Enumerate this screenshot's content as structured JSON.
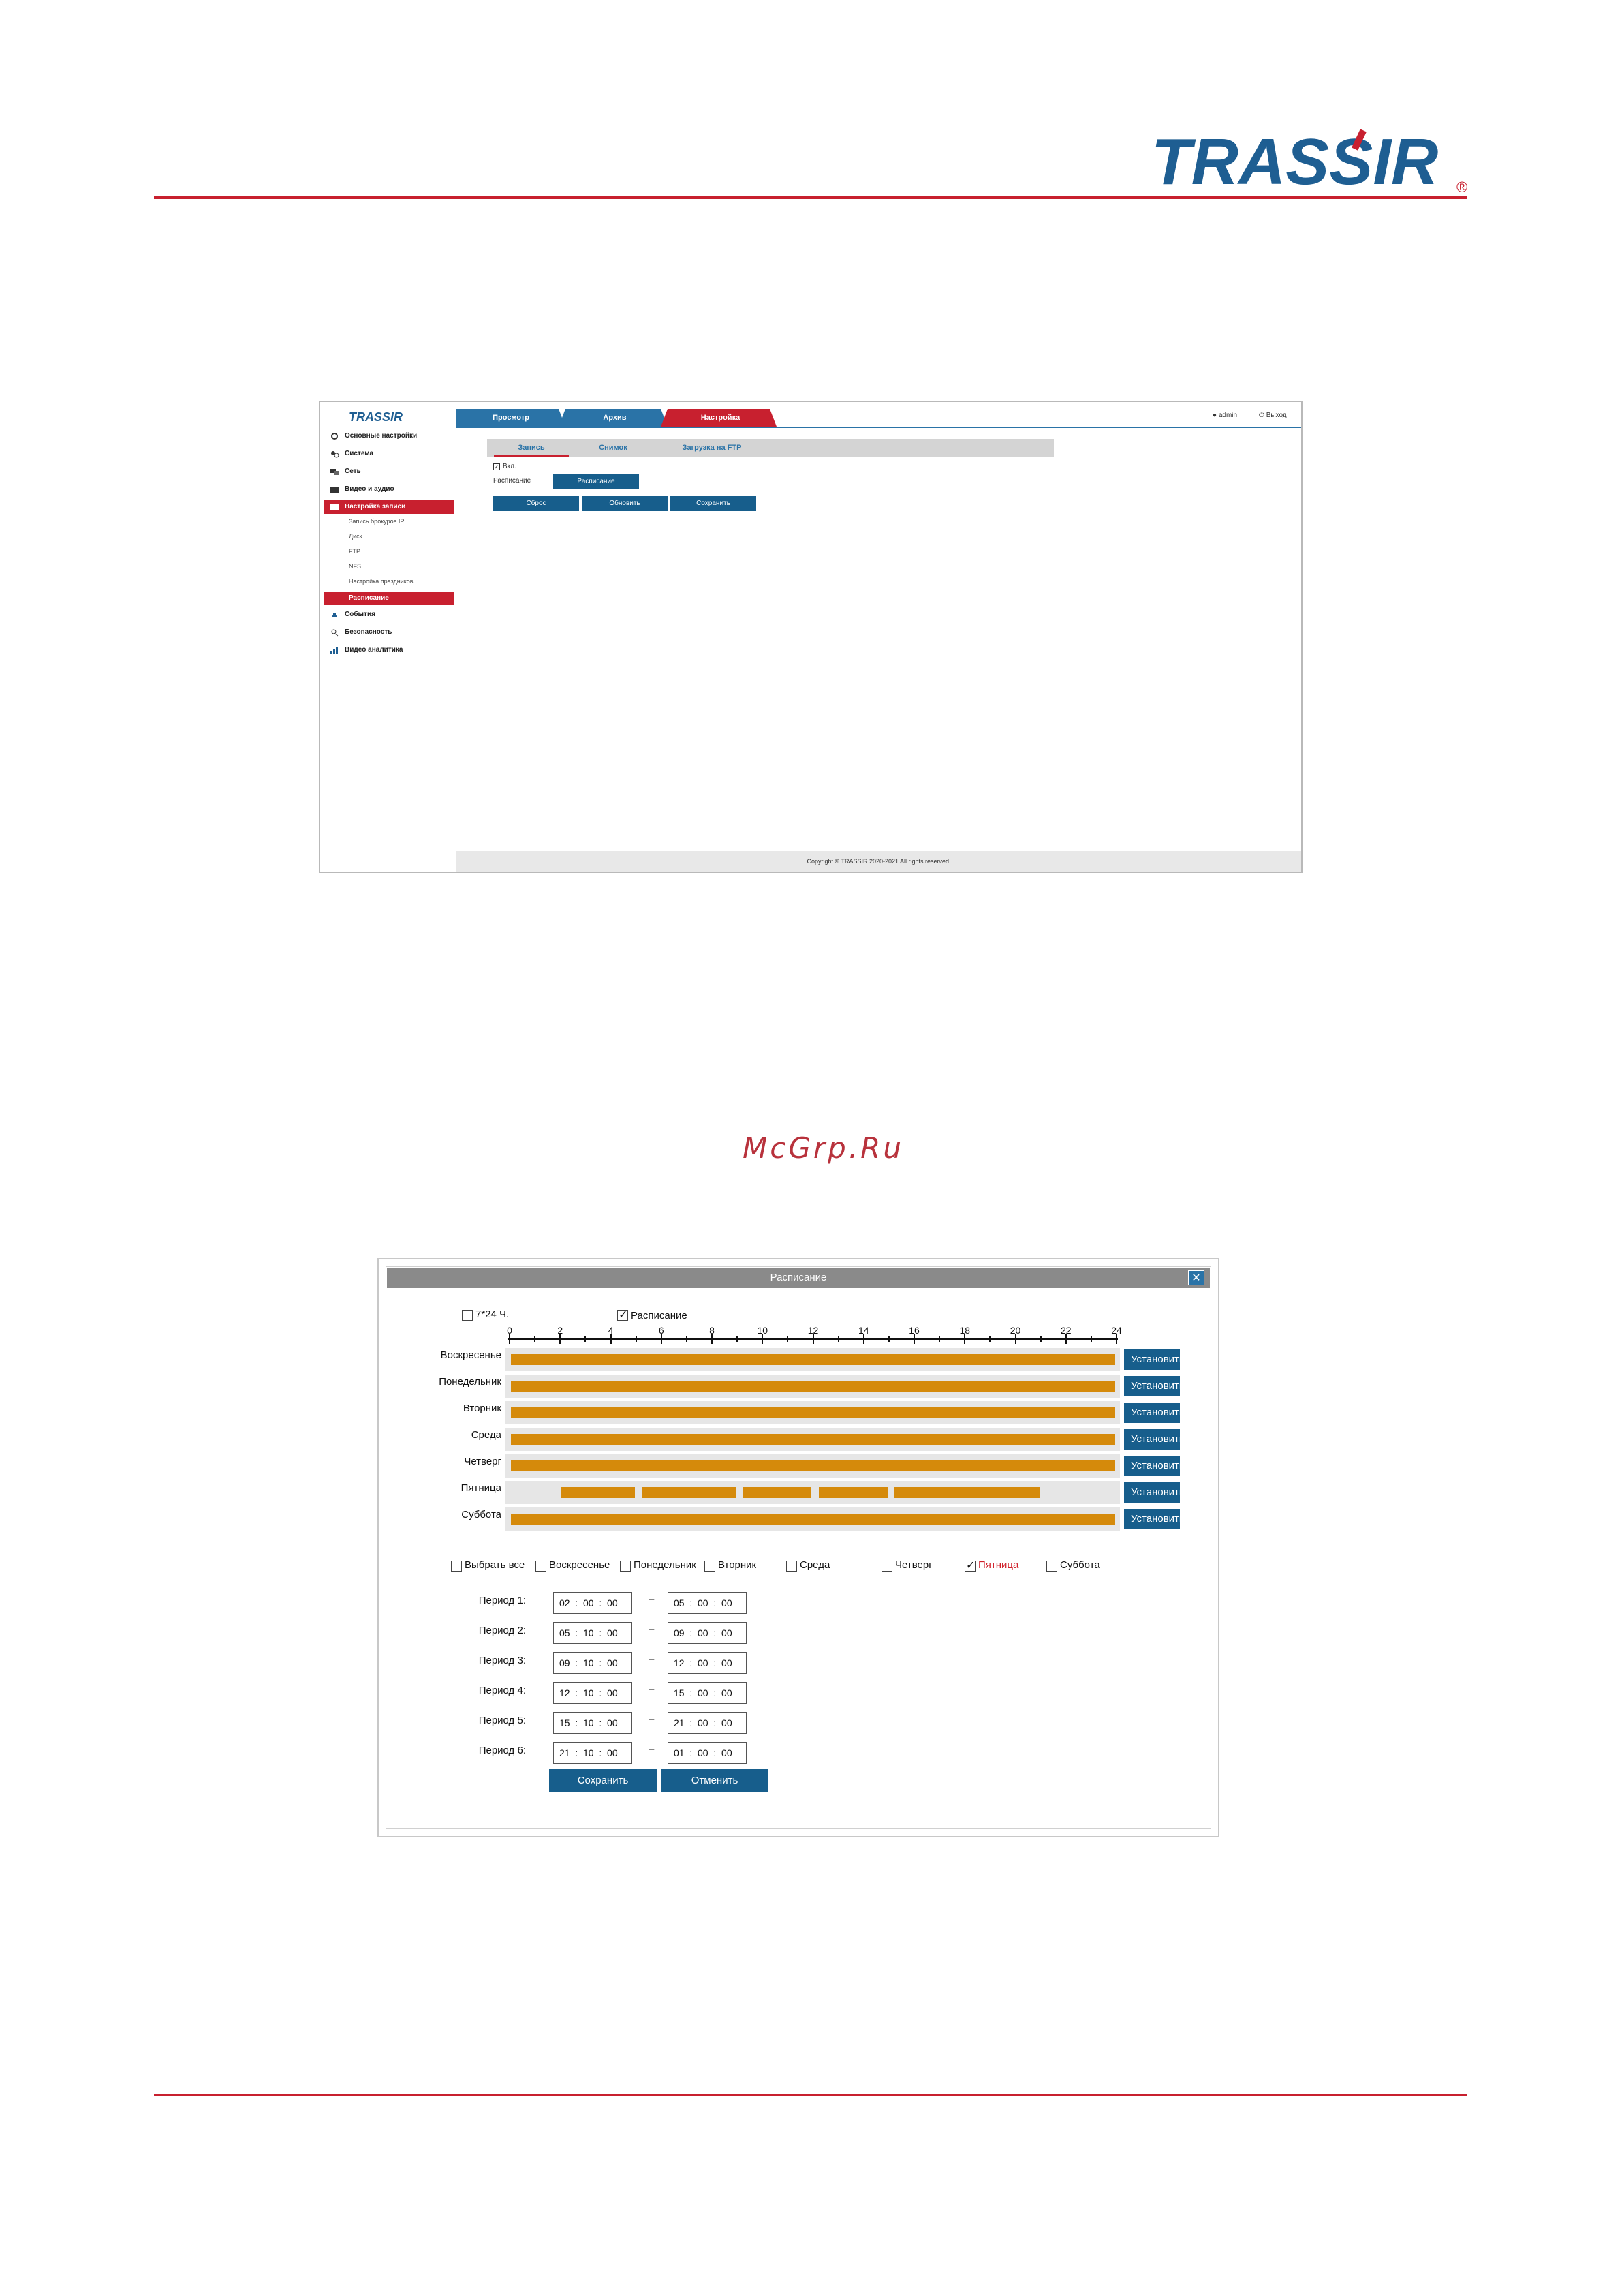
{
  "brand": {
    "logo_text": "TRASSIR",
    "registered": "®",
    "accent": "#c8202f",
    "blue": "#1e5e92"
  },
  "watermark": "McGrp.Ru",
  "shot1": {
    "logo_text": "TRASSIR",
    "top_tabs": [
      "Просмотр",
      "Архив",
      "Настройка"
    ],
    "user": "admin",
    "exit": "Выход",
    "sidebar": {
      "items": [
        {
          "label": "Основные настройки",
          "icon": "gear-icon"
        },
        {
          "label": "Система",
          "icon": "system-icon"
        },
        {
          "label": "Сеть",
          "icon": "network-icon"
        },
        {
          "label": "Видео и аудио",
          "icon": "film-icon"
        },
        {
          "label": "Настройка записи",
          "icon": "record-icon"
        }
      ],
      "sub_items": [
        "Запись брокуров IP",
        "Диск",
        "FTP",
        "NFS",
        "Настройка праздников"
      ],
      "sub_active": "Расписание",
      "items_after": [
        {
          "label": "События",
          "icon": "bell-icon"
        },
        {
          "label": "Безопасность",
          "icon": "security-icon"
        },
        {
          "label": "Видео аналитика",
          "icon": "analytics-icon"
        }
      ]
    },
    "sub_tabs": [
      "Запись",
      "Снимок",
      "Загрузка на FTP"
    ],
    "enable_label": "Вкл.",
    "schedule_label": "Расписание",
    "schedule_button": "Расписание",
    "buttons": [
      "Сброс",
      "Обновить",
      "Сохранить"
    ],
    "footer": "Copyright © TRASSIR 2020-2021 All rights reserved."
  },
  "shot2": {
    "title": "Расписание",
    "close": "✕",
    "option_247": "7*24 Ч.",
    "option_schedule": "Расписание",
    "ticks": [
      "0",
      "2",
      "4",
      "6",
      "8",
      "10",
      "12",
      "14",
      "16",
      "18",
      "20",
      "22",
      "24"
    ],
    "days": [
      {
        "name": "Воскресенье",
        "segments": [
          [
            0,
            24
          ]
        ]
      },
      {
        "name": "Понедельник",
        "segments": [
          [
            0,
            24
          ]
        ]
      },
      {
        "name": "Вторник",
        "segments": [
          [
            0,
            24
          ]
        ]
      },
      {
        "name": "Среда",
        "segments": [
          [
            0,
            24
          ]
        ]
      },
      {
        "name": "Четверг",
        "segments": [
          [
            0,
            24
          ]
        ]
      },
      {
        "name": "Пятница",
        "segments": [
          [
            2,
            5
          ],
          [
            5.17,
            9
          ],
          [
            9.17,
            12
          ],
          [
            12.17,
            15
          ],
          [
            15.17,
            21
          ]
        ]
      },
      {
        "name": "Суббота",
        "segments": [
          [
            0,
            24
          ]
        ]
      }
    ],
    "set_button": "Установить",
    "select_all": "Выбрать все",
    "day_checks": [
      {
        "label": "Воскресенье",
        "checked": false
      },
      {
        "label": "Понедельник",
        "checked": false
      },
      {
        "label": "Вторник",
        "checked": false
      },
      {
        "label": "Среда",
        "checked": false
      },
      {
        "label": "Четверг",
        "checked": false
      },
      {
        "label": "Пятница",
        "checked": true
      },
      {
        "label": "Суббота",
        "checked": false
      }
    ],
    "periods": [
      {
        "label": "Период 1:",
        "from": "02  :  00  :  00",
        "to": "05  :  00  :  00"
      },
      {
        "label": "Период 2:",
        "from": "05  :  10  :  00",
        "to": "09  :  00  :  00"
      },
      {
        "label": "Период 3:",
        "from": "09  :  10  :  00",
        "to": "12  :  00  :  00"
      },
      {
        "label": "Период 4:",
        "from": "12  :  10  :  00",
        "to": "15  :  00  :  00"
      },
      {
        "label": "Период 5:",
        "from": "15  :  10  :  00",
        "to": "21  :  00  :  00"
      },
      {
        "label": "Период 6:",
        "from": "21  :  10  :  00",
        "to": "01  :  00  :  00"
      }
    ],
    "dash": "–",
    "save": "Сохранить",
    "cancel": "Отменить"
  }
}
